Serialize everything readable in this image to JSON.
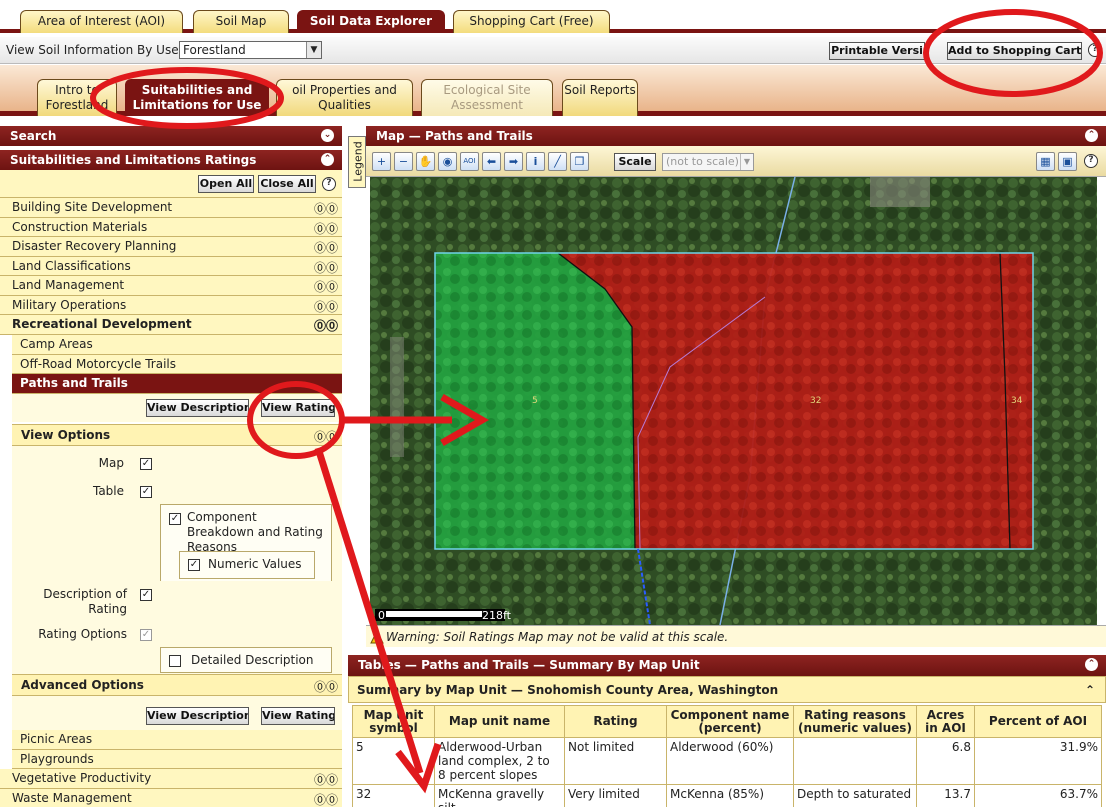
{
  "top_tabs": [
    "Area of Interest (AOI)",
    "Soil Map",
    "Soil Data Explorer",
    "Shopping Cart (Free)"
  ],
  "view_by": {
    "label": "View Soil Information By Use:",
    "value": "Forestland"
  },
  "toolbar": {
    "printable": "Printable Versi",
    "add_to_cart": "Add to Shopping Cart"
  },
  "sub_tabs": [
    "Intro to Forestland",
    "Suitabilities and Limitations for Use",
    "oil Properties and Qualities",
    "Ecological Site Assessment",
    "Soil Reports"
  ],
  "left": {
    "search": "Search",
    "ratings_header": "Suitabilities and Limitations Ratings",
    "open_all": "Open All",
    "close_all": "Close All",
    "categories": [
      "Building Site Development",
      "Construction Materials",
      "Disaster Recovery Planning",
      "Land Classifications",
      "Land Management",
      "Military Operations",
      "Recreational Development"
    ],
    "rec_items": [
      "Camp Areas",
      "Off-Road Motorcycle Trails",
      "Paths and Trails"
    ],
    "view_description": "View Description",
    "view_rating": "View Rating",
    "view_options": "View Options",
    "map_label": "Map",
    "table_label": "Table",
    "component_breakdown": "Component Breakdown and Rating Reasons",
    "numeric_values": "Numeric Values",
    "description_of_rating": "Description of Rating",
    "rating_options": "Rating Options",
    "detailed_description": "Detailed Description",
    "advanced_options": "Advanced Options",
    "rec_items_bottom": [
      "Picnic Areas",
      "Playgrounds"
    ],
    "categories_bottom": [
      "Vegetative Productivity",
      "Waste Management"
    ]
  },
  "map": {
    "title": "Map — Paths and Trails",
    "legend": "Legend",
    "scale_btn": "Scale",
    "scale_value": "(not to scale)",
    "scale_bar_start": "0",
    "scale_bar_end": "218ft",
    "unit_labels": [
      "5",
      "32",
      "34"
    ],
    "warning": "Warning: Soil Ratings Map may not be valid at this scale."
  },
  "tables": {
    "title": "Tables — Paths and Trails — Summary By Map Unit",
    "summary_title": "Summary by Map Unit — Snohomish County Area, Washington",
    "columns": [
      "Map unit symbol",
      "Map unit name",
      "Rating",
      "Component name (percent)",
      "Rating reasons (numeric values)",
      "Acres in AOI",
      "Percent of AOI"
    ],
    "rows": [
      [
        "5",
        "Alderwood-Urban land complex, 2 to 8 percent slopes",
        "Not limited",
        "Alderwood (60%)",
        "",
        "6.8",
        "31.9%"
      ],
      [
        "32",
        "McKenna gravelly silt",
        "Very limited",
        "McKenna (85%)",
        "Depth to saturated",
        "13.7",
        "63.7%"
      ]
    ]
  },
  "colors": {
    "accent": "#7a1412",
    "tab_fill": "#f3dc7d",
    "annotation": "#e0191c",
    "limited_red": "#b51a14",
    "not_limited_green": "#1f9b3a"
  }
}
